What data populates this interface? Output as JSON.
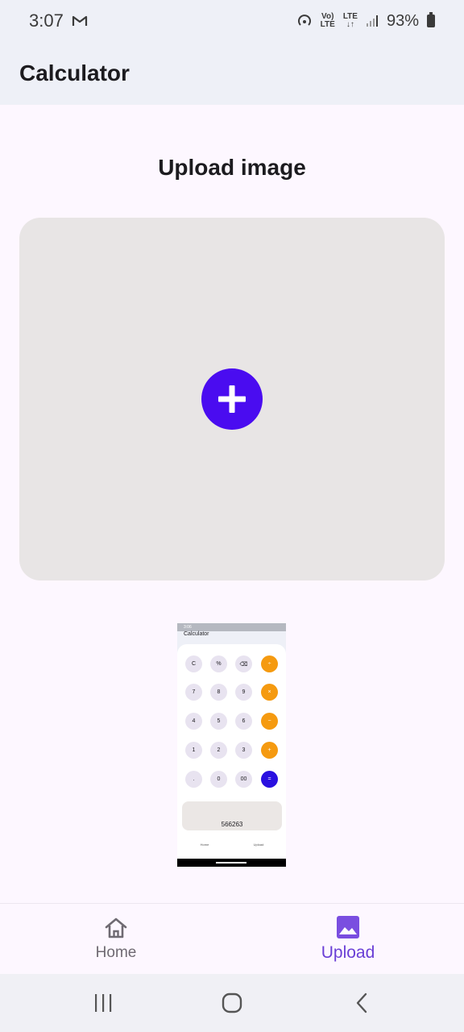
{
  "status_bar": {
    "time": "3:07",
    "network_top": "Vo)",
    "network_bottom": "LTE",
    "lte_top": "LTE",
    "battery": "93%"
  },
  "app_bar": {
    "title": "Calculator"
  },
  "main": {
    "heading": "Upload image",
    "add_icon": "plus-icon",
    "accent_color": "#4a0cf0"
  },
  "thumbnail": {
    "app_title": "Calculator",
    "status_text": "3:06",
    "keys": [
      [
        "C",
        "%",
        "⌫",
        "÷"
      ],
      [
        "7",
        "8",
        "9",
        "×"
      ],
      [
        "4",
        "5",
        "6",
        "−"
      ],
      [
        "1",
        "2",
        "3",
        "+"
      ],
      [
        ".",
        "0",
        "00",
        "="
      ]
    ],
    "display_value": "566263",
    "nav_home": "Home",
    "nav_upload": "Upload"
  },
  "bottom_nav": {
    "items": [
      {
        "label": "Home",
        "icon": "home-icon"
      },
      {
        "label": "Upload",
        "icon": "image-icon",
        "selected": true
      }
    ]
  },
  "system_nav": {
    "recents": "recents-icon",
    "home": "home-circle-icon",
    "back": "back-icon"
  }
}
